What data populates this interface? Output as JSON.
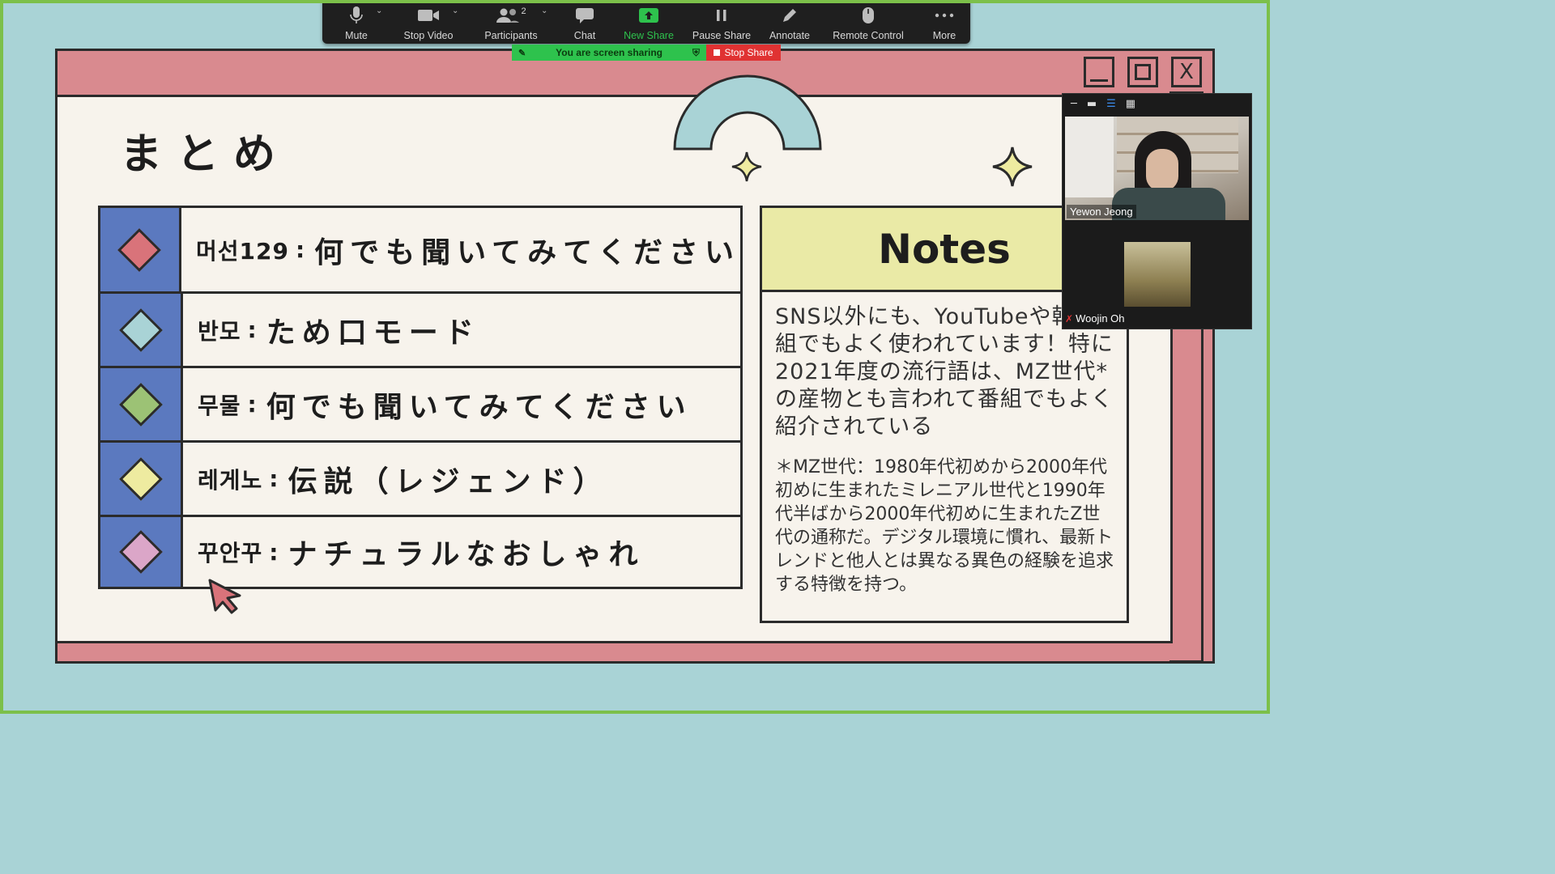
{
  "toolbar": {
    "mute": "Mute",
    "stop_video": "Stop Video",
    "participants": "Participants",
    "participants_count": "2",
    "chat": "Chat",
    "new_share": "New Share",
    "pause_share": "Pause Share",
    "annotate": "Annotate",
    "remote_control": "Remote Control",
    "more": "More"
  },
  "share_bar": {
    "status": "You are screen sharing",
    "stop": "Stop Share"
  },
  "slide": {
    "title": "まとめ",
    "window_buttons": {
      "close": "X"
    },
    "rows": [
      {
        "ko": "머선129",
        "sep": ":",
        "ja": "何でも聞いてみてください",
        "color": "#d9737a"
      },
      {
        "ko": "반모",
        "sep": ":",
        "ja": "ため口モード",
        "color": "#a9d3d6"
      },
      {
        "ko": "무물",
        "sep": ":",
        "ja": "何でも聞いてみてください",
        "color": "#9cc275"
      },
      {
        "ko": "레게노",
        "sep": ":",
        "ja": "伝説（レジェンド）",
        "color": "#eeeba0"
      },
      {
        "ko": "꾸안꾸",
        "sep": ":",
        "ja": "ナチュラルなおしゃれ",
        "color": "#dba6c8"
      }
    ],
    "notes": {
      "heading": "Notes",
      "body": "SNS以外にも、YouTubeや韓番組でもよく使われています！特に2021年度の流行語は、MZ世代*の産物とも言われて番組でもよく紹介されている",
      "footnote": "＊MZ世代：1980年代初めから2000年代初めに生まれたミレニアル世代と1990年代半ばから2000年代初めに生まれたZ世代の通称だ。デジタル環境に慣れ、最新トレンドと他人とは異なる異色の経験を追求する特徴を持つ。"
    }
  },
  "video": {
    "participant1": "Yewon Jeong",
    "participant2": "Woojin Oh"
  },
  "colors": {
    "background": "#a9d3d6",
    "window_frame": "#d98a8f",
    "paper": "#f7f3ec",
    "side_column": "#5b79bf",
    "notes_header": "#eaeaa6",
    "share_green": "#2ec24d",
    "stop_red": "#e03232"
  }
}
